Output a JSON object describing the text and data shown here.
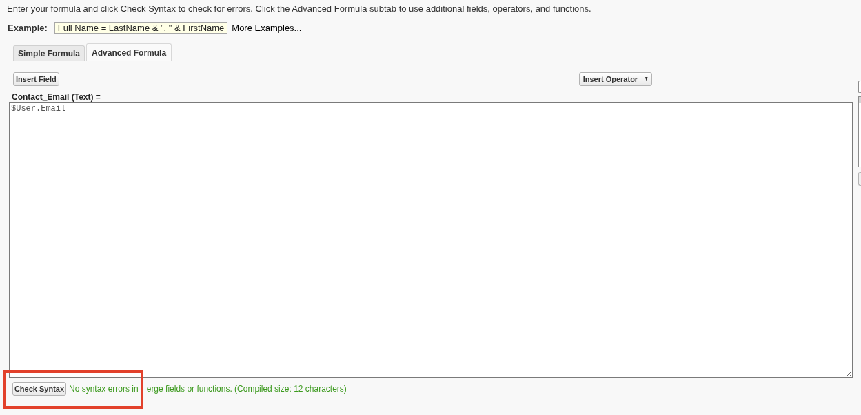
{
  "instructions": "Enter your formula and click Check Syntax to check for errors. Click the Advanced Formula subtab to use additional fields, operators, and functions.",
  "example": {
    "label": "Example:",
    "value": "Full Name = LastName & \", \" & FirstName",
    "link": "More Examples..."
  },
  "tabs": [
    {
      "label": "Simple Formula",
      "selected": false
    },
    {
      "label": "Advanced Formula",
      "selected": true
    }
  ],
  "toolbar": {
    "insert_field": "Insert Field",
    "insert_operator": "Insert Operator"
  },
  "formula": {
    "label": "Contact_Email (Text) =",
    "value": "$User.Email"
  },
  "check_syntax": {
    "button": "Check Syntax",
    "message_parts": [
      "No syntax errors in",
      "erge fields or functions. (Compiled size: 12 characters)"
    ]
  }
}
